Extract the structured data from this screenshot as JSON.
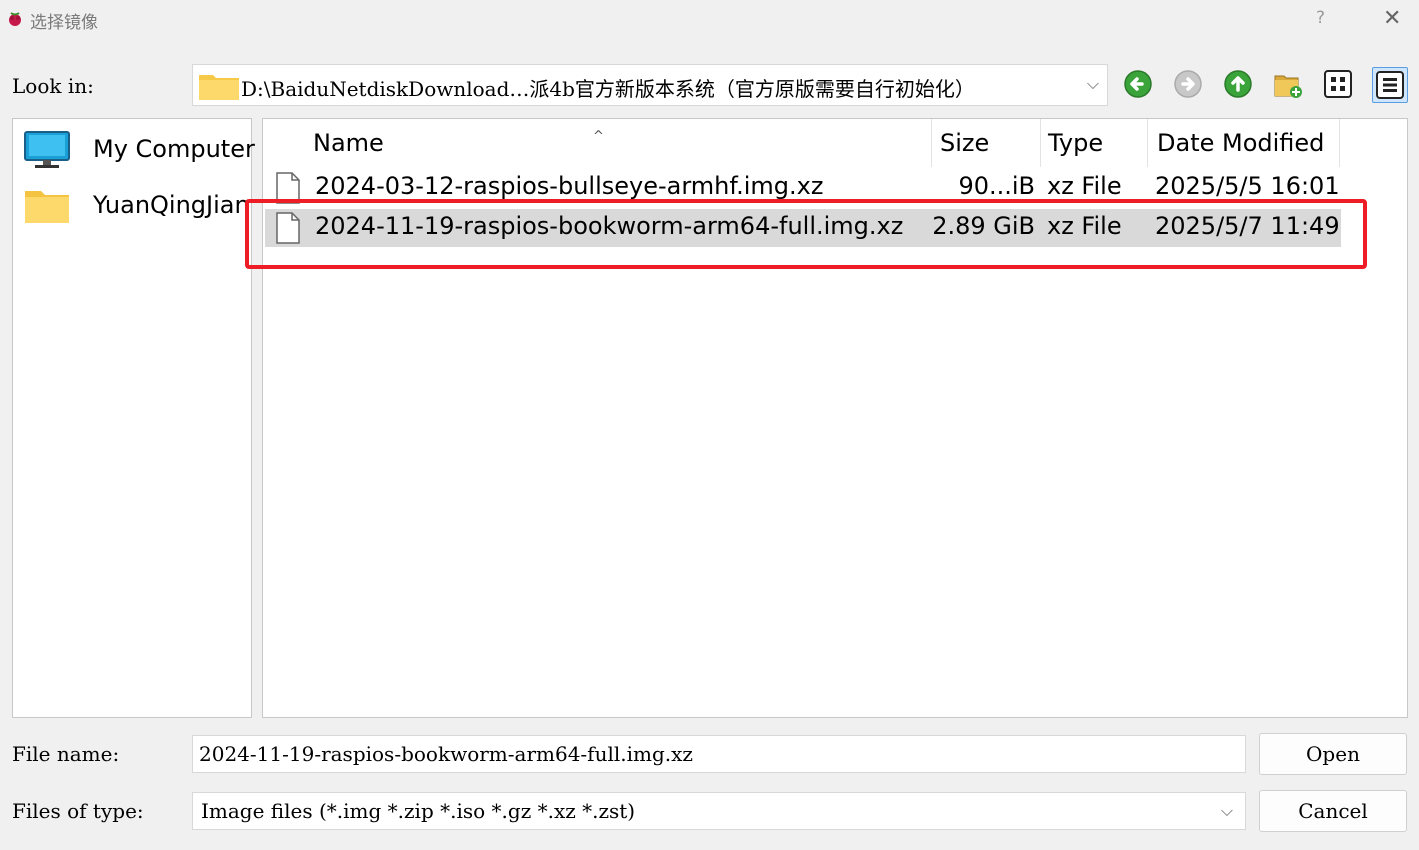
{
  "window": {
    "title": "选择镜像",
    "help_label": "?",
    "close_label": "✕"
  },
  "lookin": {
    "label": "Look in:",
    "path": "D:\\BaiduNetdiskDownload…派4b官方新版本系统（官方原版需要自行初始化）",
    "dropdown_icon": "chevron-down-icon"
  },
  "toolbar": {
    "icons": [
      "back-arrow-icon",
      "forward-arrow-icon",
      "up-arrow-icon",
      "new-folder-icon",
      "list-view-icon",
      "detail-view-icon"
    ]
  },
  "sidebar": {
    "items": [
      {
        "label": "My Computer",
        "icon": "computer-icon"
      },
      {
        "label": "YuanQingJian",
        "icon": "folder-icon"
      }
    ]
  },
  "filelist": {
    "columns": [
      "Name",
      "Size",
      "Type",
      "Date Modified"
    ],
    "rows": [
      {
        "name": "2024-03-12-raspios-bullseye-armhf.img.xz",
        "size": "90...iB",
        "type": "xz File",
        "date": "2025/5/5 16:01",
        "selected": false
      },
      {
        "name": "2024-11-19-raspios-bookworm-arm64-full.img.xz",
        "size": "2.89 GiB",
        "type": "xz File",
        "date": "2025/5/7 11:49",
        "selected": true
      }
    ]
  },
  "bottom": {
    "filename_label": "File name:",
    "filename_value": "2024-11-19-raspios-bookworm-arm64-full.img.xz",
    "filetype_label": "Files of type:",
    "filetype_value": "Image files (*.img *.zip *.iso *.gz *.xz *.zst)",
    "open_label": "Open",
    "cancel_label": "Cancel"
  },
  "colors": {
    "highlight": "#ee1c24",
    "selection": "#d9d9d9",
    "nav_green": "#3aa33a"
  }
}
